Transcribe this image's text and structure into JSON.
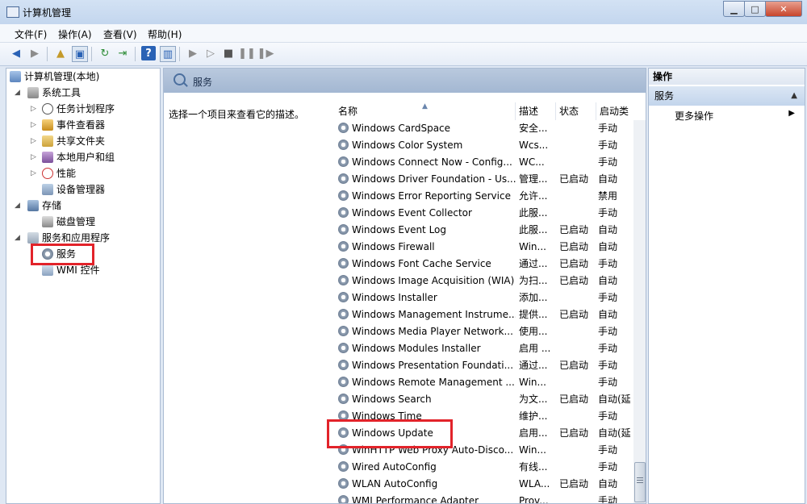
{
  "window": {
    "title": "计算机管理"
  },
  "menubar": {
    "items": [
      "文件(F)",
      "操作(A)",
      "查看(V)",
      "帮助(H)"
    ]
  },
  "tree": {
    "items": [
      {
        "label": "计算机管理(本地)",
        "name": "tree-computer-management"
      },
      {
        "label": "系统工具",
        "name": "tree-system-tools"
      },
      {
        "label": "任务计划程序",
        "name": "tree-task-scheduler"
      },
      {
        "label": "事件查看器",
        "name": "tree-event-viewer"
      },
      {
        "label": "共享文件夹",
        "name": "tree-shared-folders"
      },
      {
        "label": "本地用户和组",
        "name": "tree-local-users-groups"
      },
      {
        "label": "性能",
        "name": "tree-performance"
      },
      {
        "label": "设备管理器",
        "name": "tree-device-manager"
      },
      {
        "label": "存储",
        "name": "tree-storage"
      },
      {
        "label": "磁盘管理",
        "name": "tree-disk-management"
      },
      {
        "label": "服务和应用程序",
        "name": "tree-services-apps"
      },
      {
        "label": "服务",
        "name": "tree-services"
      },
      {
        "label": "WMI 控件",
        "name": "tree-wmi-control"
      }
    ]
  },
  "center": {
    "header_title": "服务",
    "description_hint": "选择一个项目来查看它的描述。",
    "columns": {
      "name": "名称",
      "desc": "描述",
      "status": "状态",
      "start": "启动类"
    },
    "services": [
      {
        "name": "Windows CardSpace",
        "desc": "安全...",
        "status": "",
        "start": "手动"
      },
      {
        "name": "Windows Color System",
        "desc": "Wcs...",
        "status": "",
        "start": "手动"
      },
      {
        "name": "Windows Connect Now - Config...",
        "desc": "WC...",
        "status": "",
        "start": "手动"
      },
      {
        "name": "Windows Driver Foundation - Us...",
        "desc": "管理...",
        "status": "已启动",
        "start": "自动"
      },
      {
        "name": "Windows Error Reporting Service",
        "desc": "允许...",
        "status": "",
        "start": "禁用"
      },
      {
        "name": "Windows Event Collector",
        "desc": "此服...",
        "status": "",
        "start": "手动"
      },
      {
        "name": "Windows Event Log",
        "desc": "此服...",
        "status": "已启动",
        "start": "自动"
      },
      {
        "name": "Windows Firewall",
        "desc": "Win...",
        "status": "已启动",
        "start": "自动"
      },
      {
        "name": "Windows Font Cache Service",
        "desc": "通过...",
        "status": "已启动",
        "start": "手动"
      },
      {
        "name": "Windows Image Acquisition (WIA)",
        "desc": "为扫...",
        "status": "已启动",
        "start": "自动"
      },
      {
        "name": "Windows Installer",
        "desc": "添加...",
        "status": "",
        "start": "手动"
      },
      {
        "name": "Windows Management Instrume...",
        "desc": "提供...",
        "status": "已启动",
        "start": "自动"
      },
      {
        "name": "Windows Media Player Network...",
        "desc": "使用...",
        "status": "",
        "start": "手动"
      },
      {
        "name": "Windows Modules Installer",
        "desc": "启用 ...",
        "status": "",
        "start": "手动"
      },
      {
        "name": "Windows Presentation Foundati...",
        "desc": "通过...",
        "status": "已启动",
        "start": "手动"
      },
      {
        "name": "Windows Remote Management ...",
        "desc": "Win...",
        "status": "",
        "start": "手动"
      },
      {
        "name": "Windows Search",
        "desc": "为文...",
        "status": "已启动",
        "start": "自动(延"
      },
      {
        "name": "Windows Time",
        "desc": "维护...",
        "status": "",
        "start": "手动"
      },
      {
        "name": "Windows Update",
        "desc": "启用...",
        "status": "已启动",
        "start": "自动(延"
      },
      {
        "name": "WinHTTP Web Proxy Auto-Disco...",
        "desc": "Win...",
        "status": "",
        "start": "手动"
      },
      {
        "name": "Wired AutoConfig",
        "desc": "有线...",
        "status": "",
        "start": "手动"
      },
      {
        "name": "WLAN AutoConfig",
        "desc": "WLA...",
        "status": "已启动",
        "start": "自动"
      },
      {
        "name": "WMI Performance Adapter",
        "desc": "Prov...",
        "status": "",
        "start": "手动"
      }
    ]
  },
  "actions": {
    "header": "操作",
    "section": "服务",
    "more": "更多操作"
  },
  "colors": {
    "highlight_red": "#e2232a",
    "header_blue": "#a3b7d2"
  }
}
